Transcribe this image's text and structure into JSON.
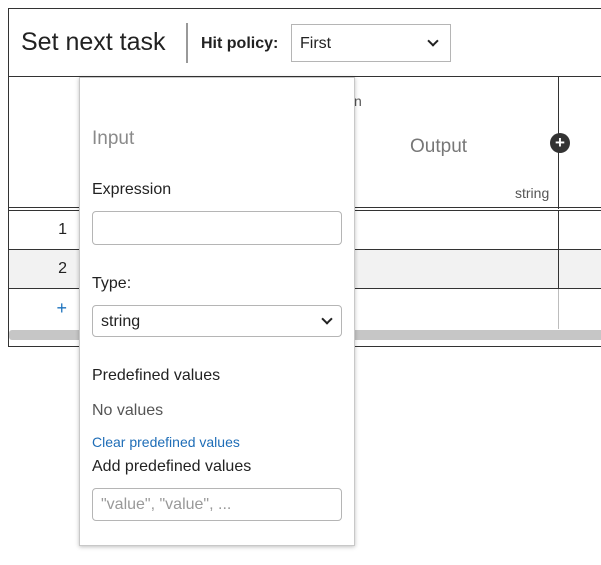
{
  "table": {
    "title": "Set next task",
    "hit_policy_label": "Hit policy:",
    "hit_policy_value": "First",
    "output_column": {
      "label": "Output",
      "type": "string"
    },
    "input_column_label_fragment": "n",
    "rows": [
      {
        "number": "1"
      },
      {
        "number": "2"
      }
    ],
    "add_row_label": "+"
  },
  "popup": {
    "title": "Input",
    "expression_label": "Expression",
    "expression_value": "",
    "type_label": "Type:",
    "type_value": "string",
    "predefined_label": "Predefined values",
    "no_values_text": "No values",
    "clear_link": "Clear predefined values",
    "add_predefined_label": "Add predefined values",
    "add_predefined_placeholder": "\"value\", \"value\", ..."
  },
  "colors": {
    "link": "#1e6db7",
    "add_row": "#1e73be",
    "border": "#333333"
  }
}
